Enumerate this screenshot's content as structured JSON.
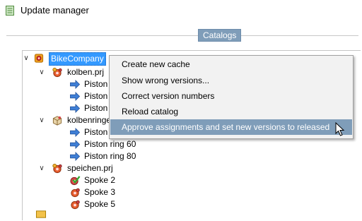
{
  "window": {
    "title": "Update manager"
  },
  "group": {
    "legend": "Catalogs"
  },
  "tree": {
    "root": {
      "label": "BikeCompany"
    },
    "projects": [
      {
        "label": "kolben.prj",
        "children": [
          "Piston",
          "Piston",
          "Piston"
        ]
      },
      {
        "label": "kolbenringe",
        "children": [
          "Piston ring",
          "Piston ring 60",
          "Piston ring 80"
        ]
      },
      {
        "label": "speichen.prj",
        "children": [
          "Spoke 2",
          "Spoke 3",
          "Spoke 5"
        ]
      }
    ]
  },
  "context_menu": {
    "items": [
      "Create  new cache",
      "Show wrong versions...",
      "Correct version numbers",
      "Reload catalog",
      "Approve assignments and set new versions to released"
    ],
    "highlighted_index": 4
  },
  "colors": {
    "selection": "#3399ff",
    "menu_highlight": "#7f9db9",
    "arrow_icon": "#3f7fd6",
    "check_icon": "#2ea82e"
  }
}
